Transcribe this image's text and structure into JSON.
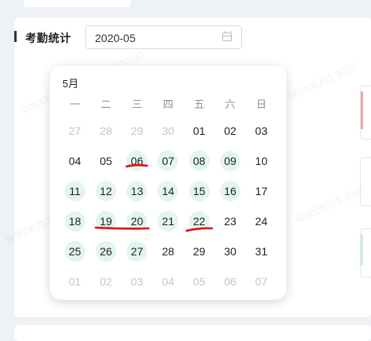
{
  "section": {
    "title": "考勤统计"
  },
  "month_picker": {
    "value": "2020-05",
    "icon": "calendar-icon"
  },
  "calendar": {
    "month_label": "5月",
    "weekdays": [
      "一",
      "二",
      "三",
      "四",
      "五",
      "六",
      "日"
    ],
    "days": [
      {
        "label": "27",
        "other": true,
        "marked": false
      },
      {
        "label": "28",
        "other": true,
        "marked": false
      },
      {
        "label": "29",
        "other": true,
        "marked": false
      },
      {
        "label": "30",
        "other": true,
        "marked": false
      },
      {
        "label": "01",
        "other": false,
        "marked": false
      },
      {
        "label": "02",
        "other": false,
        "marked": false
      },
      {
        "label": "03",
        "other": false,
        "marked": false
      },
      {
        "label": "04",
        "other": false,
        "marked": false
      },
      {
        "label": "05",
        "other": false,
        "marked": false
      },
      {
        "label": "06",
        "other": false,
        "marked": true
      },
      {
        "label": "07",
        "other": false,
        "marked": true
      },
      {
        "label": "08",
        "other": false,
        "marked": true
      },
      {
        "label": "09",
        "other": false,
        "marked": true
      },
      {
        "label": "10",
        "other": false,
        "marked": false
      },
      {
        "label": "11",
        "other": false,
        "marked": true
      },
      {
        "label": "12",
        "other": false,
        "marked": true
      },
      {
        "label": "13",
        "other": false,
        "marked": true
      },
      {
        "label": "14",
        "other": false,
        "marked": true
      },
      {
        "label": "15",
        "other": false,
        "marked": true
      },
      {
        "label": "16",
        "other": false,
        "marked": true
      },
      {
        "label": "17",
        "other": false,
        "marked": false
      },
      {
        "label": "18",
        "other": false,
        "marked": true
      },
      {
        "label": "19",
        "other": false,
        "marked": true
      },
      {
        "label": "20",
        "other": false,
        "marked": true
      },
      {
        "label": "21",
        "other": false,
        "marked": true
      },
      {
        "label": "22",
        "other": false,
        "marked": true
      },
      {
        "label": "23",
        "other": false,
        "marked": false
      },
      {
        "label": "24",
        "other": false,
        "marked": false
      },
      {
        "label": "25",
        "other": false,
        "marked": true
      },
      {
        "label": "26",
        "other": false,
        "marked": true
      },
      {
        "label": "27",
        "other": false,
        "marked": true
      },
      {
        "label": "28",
        "other": false,
        "marked": false
      },
      {
        "label": "29",
        "other": false,
        "marked": false
      },
      {
        "label": "30",
        "other": false,
        "marked": false
      },
      {
        "label": "31",
        "other": false,
        "marked": false
      },
      {
        "label": "01",
        "other": true,
        "marked": false
      },
      {
        "label": "02",
        "other": true,
        "marked": false
      },
      {
        "label": "03",
        "other": true,
        "marked": false
      },
      {
        "label": "04",
        "other": true,
        "marked": false
      },
      {
        "label": "05",
        "other": true,
        "marked": false
      },
      {
        "label": "06",
        "other": true,
        "marked": false
      },
      {
        "label": "07",
        "other": true,
        "marked": false
      }
    ]
  },
  "annotations": {
    "underline_color": "#e0101a",
    "underlined_days": [
      "06",
      "19",
      "20",
      "22"
    ]
  },
  "colors": {
    "marked_day_bg": "#e3f6ee",
    "other_month_text": "#c2c5cb",
    "right_card_accent_1": "#f2a7a7",
    "right_card_accent_2": "#cfeee2"
  }
}
